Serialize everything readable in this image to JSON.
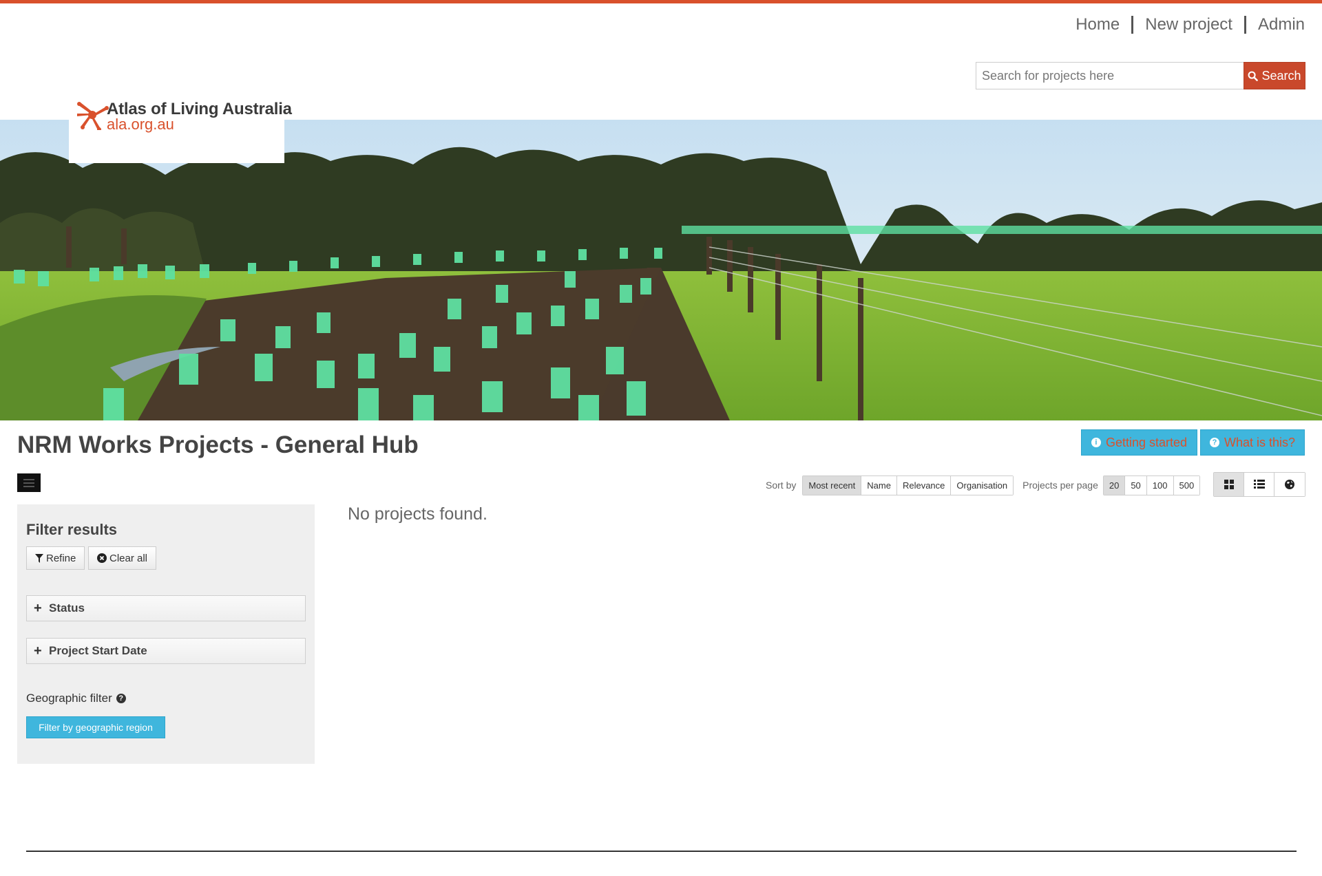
{
  "nav": {
    "home": "Home",
    "new_project": "New project",
    "admin": "Admin"
  },
  "search": {
    "placeholder": "Search for projects here",
    "button_label": "Search"
  },
  "logo": {
    "title": "Atlas of Living Australia",
    "url": "ala.org.au"
  },
  "page": {
    "title": "NRM Works Projects - General Hub",
    "getting_started": "Getting started",
    "what_is_this": "What is this?"
  },
  "sort": {
    "label": "Sort by",
    "options": [
      "Most recent",
      "Name",
      "Relevance",
      "Organisation"
    ],
    "selected": "Most recent"
  },
  "per_page": {
    "label": "Projects per page",
    "options": [
      "20",
      "50",
      "100",
      "500"
    ],
    "selected": "20"
  },
  "sidebar": {
    "title": "Filter results",
    "refine": "Refine",
    "clear_all": "Clear all",
    "facets": [
      "Status",
      "Project Start Date"
    ],
    "geo_label": "Geographic filter",
    "geo_button": "Filter by geographic region"
  },
  "results": {
    "message": "No projects found."
  },
  "colors": {
    "brand_orange": "#d9512c",
    "info_blue": "#3fb6dd",
    "sidebar_bg": "#efefef"
  }
}
